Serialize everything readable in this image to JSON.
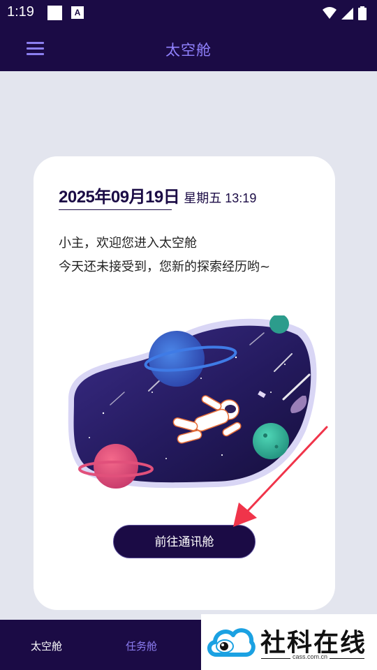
{
  "status_bar": {
    "time": "1:19",
    "a_glyph": "A"
  },
  "app_bar": {
    "title": "太空舱",
    "menu_icon": "hamburger-menu-icon"
  },
  "card": {
    "date": "2025年09月19日",
    "weekday_time": "星期五 13:19",
    "greeting_line1": "小主，欢迎您进入太空舱",
    "greeting_line2": "今天还未接受到，您新的探索经历哟~",
    "button_label": "前往通讯舱"
  },
  "bottom_nav": {
    "items": [
      {
        "label": "太空舱"
      },
      {
        "label": "任务舱"
      }
    ]
  },
  "watermark": {
    "text": "社科在线",
    "domain": "cass.com.cn"
  },
  "colors": {
    "primary": "#1B0B45",
    "accent": "#8C7FF0",
    "background": "#E3E5EE",
    "arrow": "#F0344A"
  }
}
